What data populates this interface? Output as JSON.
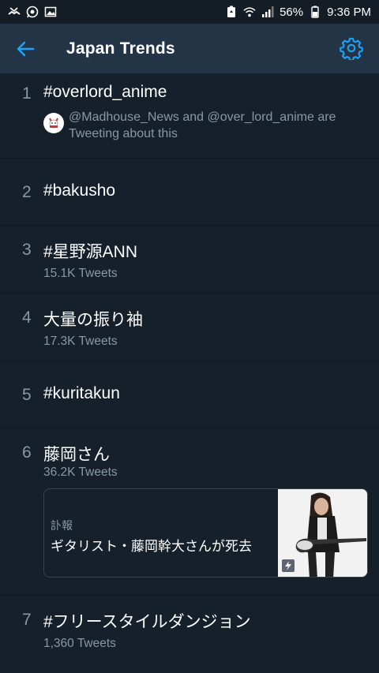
{
  "status": {
    "battery_pct": "56%",
    "time": "9:36 PM"
  },
  "header": {
    "title": "Japan Trends"
  },
  "trends": [
    {
      "rank": "1",
      "name": "#overlord_anime",
      "context": "@Madhouse_News and @over_lord_anime are Tweeting about this"
    },
    {
      "rank": "2",
      "name": "#bakusho"
    },
    {
      "rank": "3",
      "name": "#星野源ANN",
      "count": "15.1K Tweets"
    },
    {
      "rank": "4",
      "name": "大量の振り袖",
      "count": "17.3K Tweets"
    },
    {
      "rank": "5",
      "name": "#kuritakun"
    },
    {
      "rank": "6",
      "name": "藤岡さん",
      "count": "36.2K Tweets",
      "card": {
        "category": "訃報",
        "headline": "ギタリスト・藤岡幹大さんが死去"
      }
    },
    {
      "rank": "7",
      "name": "#フリースタイルダンジョン",
      "count": "1,360 Tweets"
    }
  ],
  "colors": {
    "background": "#15202b",
    "appbar": "#243447",
    "accent": "#1da1f2",
    "secondary_text": "#8899a6"
  },
  "icons": [
    "missed-call-icon",
    "whatsapp-icon",
    "image-icon",
    "battery-saver-icon",
    "wifi-icon",
    "signal-icon",
    "battery-icon",
    "back-arrow-icon",
    "gear-icon",
    "lightning-icon"
  ]
}
